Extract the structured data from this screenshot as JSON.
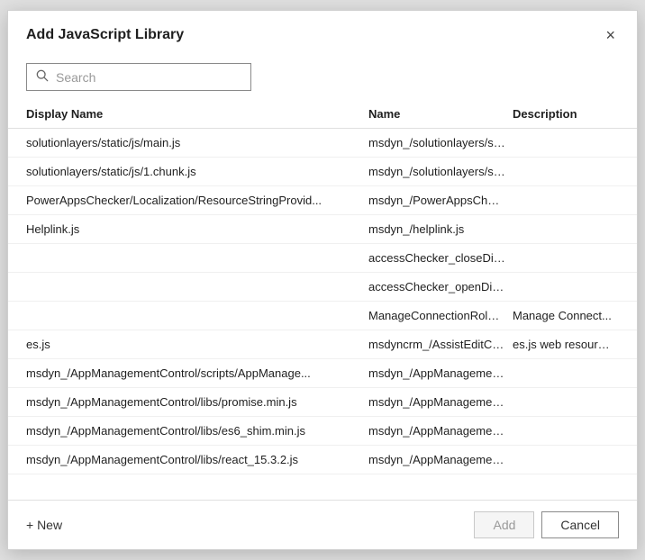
{
  "dialog": {
    "title": "Add JavaScript Library",
    "close_label": "×"
  },
  "search": {
    "placeholder": "Search"
  },
  "table": {
    "headers": [
      {
        "key": "display_name",
        "label": "Display Name"
      },
      {
        "key": "name",
        "label": "Name"
      },
      {
        "key": "description",
        "label": "Description"
      }
    ],
    "rows": [
      {
        "display_name": "solutionlayers/static/js/main.js",
        "name": "msdyn_/solutionlayers/sta...",
        "description": ""
      },
      {
        "display_name": "solutionlayers/static/js/1.chunk.js",
        "name": "msdyn_/solutionlayers/sta...",
        "description": ""
      },
      {
        "display_name": "PowerAppsChecker/Localization/ResourceStringProvid...",
        "name": "msdyn_/PowerAppsCheck...",
        "description": ""
      },
      {
        "display_name": "Helplink.js",
        "name": "msdyn_/helplink.js",
        "description": ""
      },
      {
        "display_name": "",
        "name": "accessChecker_closeDialo...",
        "description": ""
      },
      {
        "display_name": "",
        "name": "accessChecker_openDialo...",
        "description": ""
      },
      {
        "display_name": "",
        "name": "ManageConnectionRoles...",
        "description": "Manage Connect..."
      },
      {
        "display_name": "es.js",
        "name": "msdyncrm_/AssistEditCon...",
        "description": "es.js web resource."
      },
      {
        "display_name": "msdyn_/AppManagementControl/scripts/AppManage...",
        "name": "msdyn_/AppManagement...",
        "description": ""
      },
      {
        "display_name": "msdyn_/AppManagementControl/libs/promise.min.js",
        "name": "msdyn_/AppManagement...",
        "description": ""
      },
      {
        "display_name": "msdyn_/AppManagementControl/libs/es6_shim.min.js",
        "name": "msdyn_/AppManagement...",
        "description": ""
      },
      {
        "display_name": "msdyn_/AppManagementControl/libs/react_15.3.2.js",
        "name": "msdyn_/AppManagement...",
        "description": ""
      }
    ]
  },
  "footer": {
    "new_label": "+ New",
    "add_label": "Add",
    "cancel_label": "Cancel"
  }
}
